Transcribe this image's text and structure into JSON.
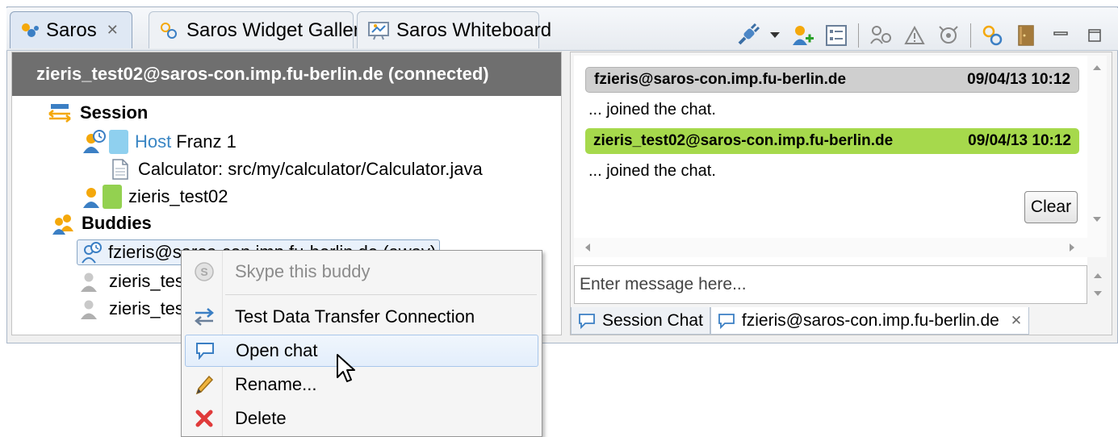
{
  "tabs": [
    {
      "label": "Saros",
      "active": true,
      "closable": true
    },
    {
      "label": "Saros Widget Gallery",
      "active": false
    },
    {
      "label": "Saros Whiteboard",
      "active": false
    }
  ],
  "left": {
    "header": "zieris_test02@saros-con.imp.fu-berlin.de (connected)",
    "session_label": "Session",
    "host_prefix": "Host",
    "host_name": "Franz 1",
    "file": "Calculator: src/my/calculator/Calculator.java",
    "participant": "zieris_test02",
    "buddies_label": "Buddies",
    "buddy1": "fzieris@saros-con.imp.fu-berlin.de (away)",
    "buddy2": "zieris_tes",
    "buddy3": "zieris_tes",
    "colors": {
      "host": "#8fd0ef",
      "participant": "#93d150"
    }
  },
  "chat": {
    "messages": [
      {
        "sender": "fzieris@saros-con.imp.fu-berlin.de",
        "time": "09/04/13 10:12",
        "text": "... joined the chat.",
        "color": "#cfcfcf"
      },
      {
        "sender": "zieris_test02@saros-con.imp.fu-berlin.de",
        "time": "09/04/13 10:12",
        "text": "... joined the chat.",
        "color": "#a6d94c"
      }
    ],
    "clear_label": "Clear",
    "input_placeholder": "Enter message here...",
    "bottom_tabs": [
      {
        "label": "Session Chat",
        "active": false
      },
      {
        "label": "fzieris@saros-con.imp.fu-berlin.de",
        "active": true,
        "closable": true
      }
    ]
  },
  "menu": {
    "items": [
      {
        "label": "Skype this buddy",
        "icon": "skype-icon",
        "disabled": true
      },
      {
        "label": "Test Data Transfer Connection",
        "icon": "transfer-icon"
      },
      {
        "label": "Open chat",
        "icon": "chat-icon",
        "hover": true
      },
      {
        "label": "Rename...",
        "icon": "pencil-icon"
      },
      {
        "label": "Delete",
        "icon": "delete-icon"
      }
    ]
  }
}
